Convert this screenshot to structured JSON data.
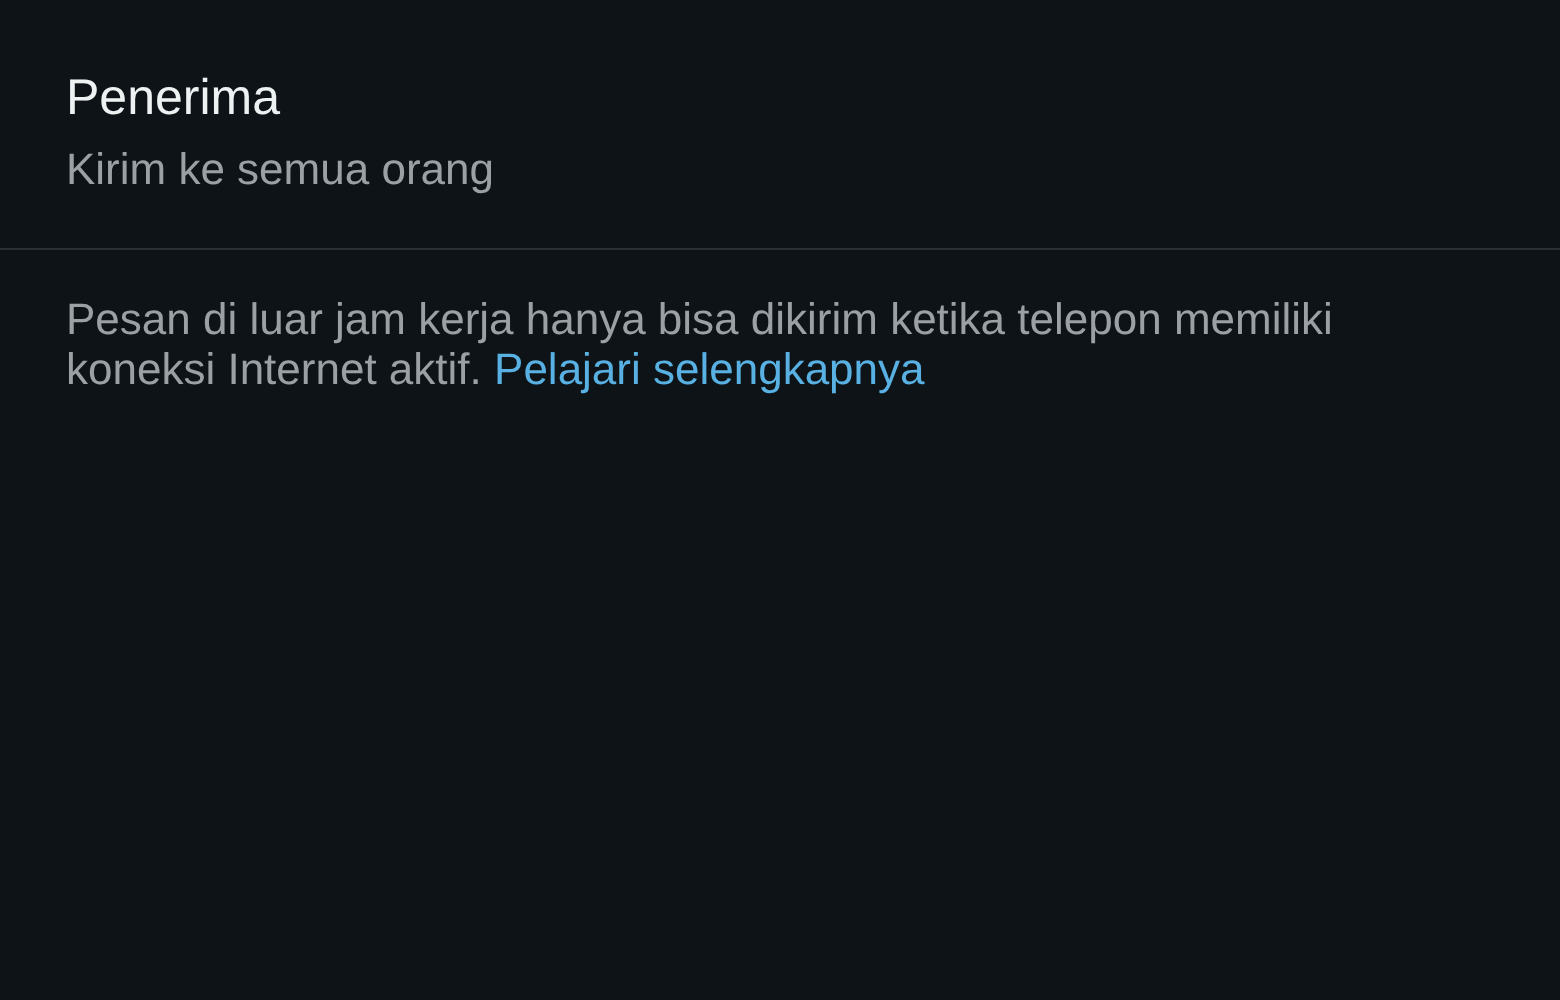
{
  "recipient": {
    "title": "Penerima",
    "value": "Kirim ke semua orang"
  },
  "note": {
    "text": "Pesan di luar jam kerja hanya bisa dikirim ketika telepon memiliki koneksi Internet aktif.",
    "link": "Pelajari selengkapnya"
  }
}
